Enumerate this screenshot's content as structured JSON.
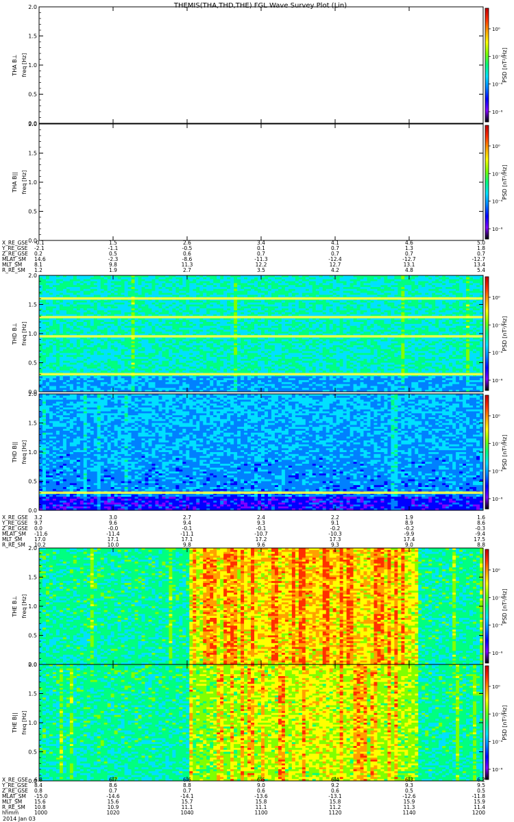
{
  "title": "THEMIS(THA,THD,THE) FGL Wave Survey Plot (Lin)",
  "date": "2014 Jan 03",
  "colors": {
    "background": "#ffffff",
    "axis": "#000000",
    "band": "#ffff40"
  },
  "colorbar_stops": [
    "#000000",
    "#7f00ff",
    "#0000ff",
    "#0080ff",
    "#00e0ff",
    "#00ff80",
    "#80ff00",
    "#ffff00",
    "#ffa000",
    "#ff3000",
    "#c00000"
  ],
  "panels": [
    {
      "id": "tha-bperp",
      "probe": "THA",
      "label": "THA B⊥",
      "ylabel": "freq [Hz]",
      "cblabel": "PSD [nT²/Hz]",
      "cbticks": [
        "10⁰",
        "10⁻²",
        "10⁻⁴",
        "10⁻⁶"
      ],
      "empty": true
    },
    {
      "id": "tha-bpar",
      "probe": "THA",
      "label": "THA B||",
      "ylabel": "freq [Hz]",
      "cblabel": "PSD [nT²/Hz]",
      "cbticks": [
        "10⁰",
        "10⁻²",
        "10⁻⁴",
        "10⁻⁶"
      ],
      "empty": true
    },
    {
      "id": "thd-bperp",
      "probe": "THD",
      "label": "THD B⊥",
      "ylabel": "freq [Hz]",
      "cblabel": "PSD [nT²/Hz]",
      "cbticks": [
        "10⁰",
        "10⁻²",
        "10⁻⁴",
        "10⁻⁶"
      ],
      "empty": false
    },
    {
      "id": "thd-bpar",
      "probe": "THD",
      "label": "THD B||",
      "ylabel": "freq [Hz]",
      "cblabel": "PSD [nT²/Hz]",
      "cbticks": [
        "10⁰",
        "10⁻²",
        "10⁻⁴",
        "10⁻⁶"
      ],
      "empty": false
    },
    {
      "id": "the-bperp",
      "probe": "THE",
      "label": "THE B⊥",
      "ylabel": "freq [Hz]",
      "cblabel": "PSD [nT²/Hz]",
      "cbticks": [
        "10⁰",
        "10⁻²",
        "10⁻⁴",
        "10⁻⁶"
      ],
      "empty": false
    },
    {
      "id": "the-bpar",
      "probe": "THE",
      "label": "THE B||",
      "ylabel": "freq [Hz]",
      "cblabel": "PSD [nT²/Hz]",
      "cbticks": [
        "10⁰",
        "10⁻²",
        "10⁻⁴",
        "10⁻⁶"
      ],
      "empty": false
    }
  ],
  "yticks": [
    "0.0",
    "0.5",
    "1.0",
    "1.5",
    "2.0"
  ],
  "ephemeris": [
    {
      "probe": "THA",
      "rows": [
        {
          "label": "X_RE_GSE",
          "values": [
            "-0.1",
            "1.5",
            "2.6",
            "3.4",
            "4.1",
            "4.6",
            "5.0"
          ]
        },
        {
          "label": "Y_RE_GSE",
          "values": [
            "-2.1",
            "-1.1",
            "-0.5",
            "0.1",
            "0.7",
            "1.3",
            "1.8"
          ]
        },
        {
          "label": "Z_RE_GSE",
          "values": [
            "0.2",
            "0.5",
            "0.6",
            "0.7",
            "0.7",
            "0.7",
            "0.7"
          ]
        },
        {
          "label": "MLAT_SM",
          "values": [
            "14.6",
            "-2.3",
            "-8.6",
            "-11.3",
            "-12.4",
            "-12.7",
            "-12.7"
          ]
        },
        {
          "label": "MLT_SM",
          "values": [
            "8.1",
            "9.8",
            "11.3",
            "12.2",
            "12.7",
            "13.1",
            "13.4"
          ]
        },
        {
          "label": "R_RE_SM",
          "values": [
            "1.2",
            "1.9",
            "2.7",
            "3.5",
            "4.2",
            "4.8",
            "5.4"
          ]
        }
      ]
    },
    {
      "probe": "THD",
      "rows": [
        {
          "label": "X_RE_GSE",
          "values": [
            "3.2",
            "3.0",
            "2.7",
            "2.4",
            "2.2",
            "1.9",
            "1.6"
          ]
        },
        {
          "label": "Y_RE_GSE",
          "values": [
            "9.7",
            "9.6",
            "9.4",
            "9.3",
            "9.1",
            "8.9",
            "8.6"
          ]
        },
        {
          "label": "Z_RE_GSE",
          "values": [
            "0.0",
            "-0.0",
            "-0.1",
            "-0.1",
            "-0.2",
            "-0.2",
            "-0.3"
          ]
        },
        {
          "label": "MLAT_SM",
          "values": [
            "-11.6",
            "-11.4",
            "-11.1",
            "-10.7",
            "-10.3",
            "-9.9",
            "-9.4"
          ]
        },
        {
          "label": "MLT_SM",
          "values": [
            "17.0",
            "17.1",
            "17.1",
            "17.2",
            "17.3",
            "17.4",
            "17.5"
          ]
        },
        {
          "label": "R_RE_SM",
          "values": [
            "10.2",
            "10.0",
            "9.8",
            "9.6",
            "9.3",
            "9.0",
            "8.8"
          ]
        }
      ]
    },
    {
      "probe": "THE",
      "rows": [
        {
          "label": "X_RE_GSE",
          "values": [
            "6.8",
            "6.7",
            "6.6",
            "6.5",
            "6.4",
            "6.3",
            "6.2"
          ]
        },
        {
          "label": "Y_RE_GSE",
          "values": [
            "8.4",
            "8.6",
            "8.8",
            "9.0",
            "9.2",
            "9.3",
            "9.5"
          ]
        },
        {
          "label": "Z_RE_GSE",
          "values": [
            "0.8",
            "0.7",
            "0.7",
            "0.6",
            "0.6",
            "0.5",
            "0.5"
          ]
        },
        {
          "label": "MLAT_SM",
          "values": [
            "-15.0",
            "-14.6",
            "-14.1",
            "-13.6",
            "-13.1",
            "-12.6",
            "-11.8"
          ]
        },
        {
          "label": "MLT_SM",
          "values": [
            "15.6",
            "15.6",
            "15.7",
            "15.8",
            "15.8",
            "15.9",
            "15.9"
          ]
        },
        {
          "label": "R_RE_SM",
          "values": [
            "10.8",
            "10.9",
            "11.1",
            "11.1",
            "11.2",
            "11.3",
            "11.4"
          ]
        },
        {
          "label": "hhmm",
          "values": [
            "1000",
            "1020",
            "1040",
            "1100",
            "1120",
            "1140",
            "1200"
          ]
        }
      ]
    }
  ],
  "chart_data": {
    "type": "heatmap",
    "title": "THEMIS(THA,THD,THE) FGL Wave Survey Plot (Lin)",
    "xlabel": "hhmm",
    "x": [
      "1000",
      "1020",
      "1040",
      "1100",
      "1120",
      "1140",
      "1200"
    ],
    "ylabel": "freq [Hz]",
    "ylim": [
      0,
      2.0
    ],
    "yticks": [
      0.0,
      0.5,
      1.0,
      1.5,
      2.0
    ],
    "colorbar_label": "PSD [nT²/Hz]",
    "colorbar_scale": "log",
    "colorbar_ticks": [
      "10⁰",
      "10⁻²",
      "10⁻⁴",
      "10⁻⁶"
    ],
    "series": [
      {
        "name": "THA B⊥",
        "data": "none"
      },
      {
        "name": "THA B||",
        "data": "none"
      },
      {
        "name": "THD B⊥",
        "features": {
          "bands_hz": [
            0.3,
            0.95,
            1.28,
            1.6
          ]
        }
      },
      {
        "name": "THD B||",
        "features": {
          "bands_hz": [
            0.3
          ]
        }
      },
      {
        "name": "THE B⊥",
        "features": {
          "enhanced_interval": [
            "1040",
            "1147"
          ]
        }
      },
      {
        "name": "THE B||",
        "features": {
          "enhanced_interval": [
            "1040",
            "1145"
          ]
        }
      }
    ]
  }
}
